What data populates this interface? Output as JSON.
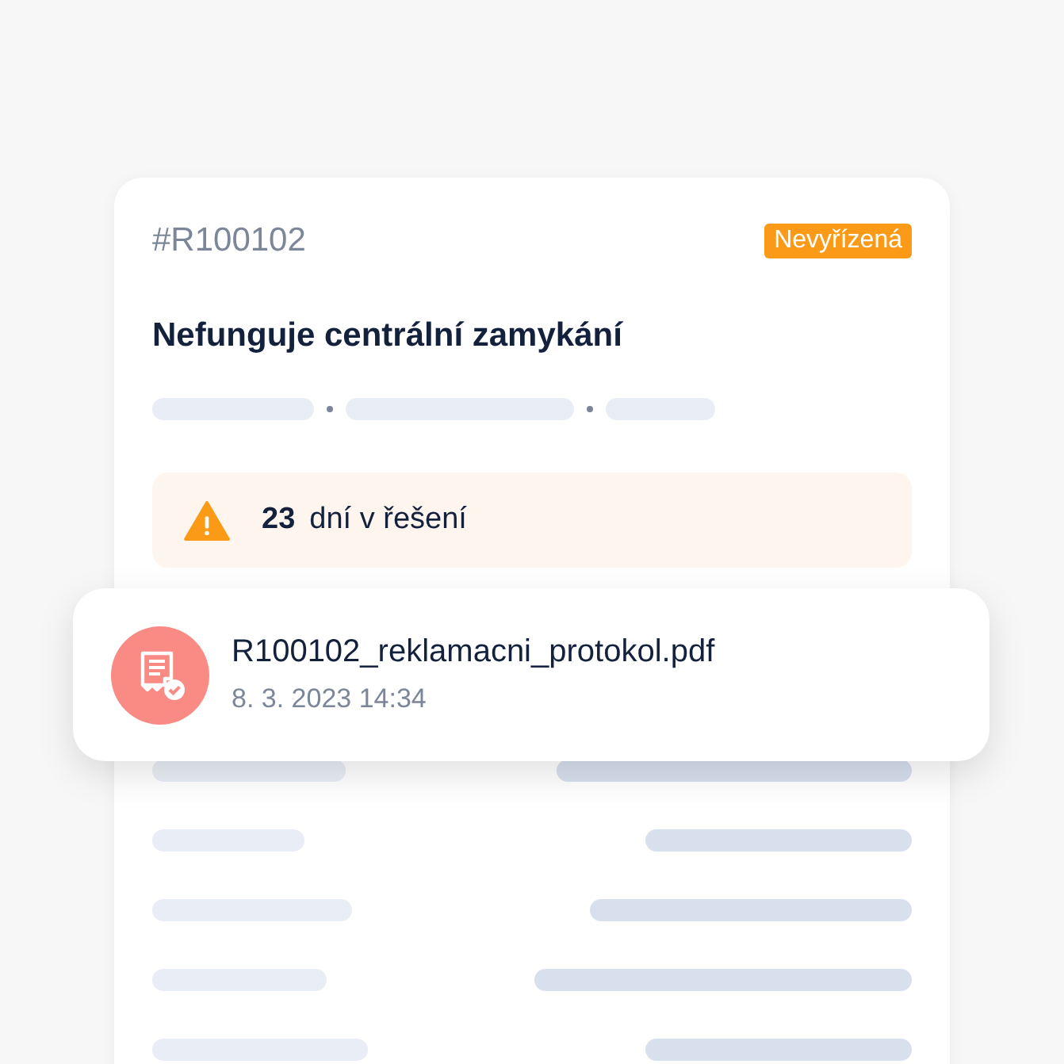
{
  "claim": {
    "number": "#R100102",
    "status": {
      "label": "Nevyřízená",
      "color": "#fb9a16"
    },
    "title": "Nefunguje centrální zamykání",
    "warning": {
      "count": "23",
      "text": "dní v řešení"
    }
  },
  "attachment": {
    "file_name": "R100102_reklamacni_protokol.pdf",
    "date": "8. 3. 2023 14:34"
  }
}
